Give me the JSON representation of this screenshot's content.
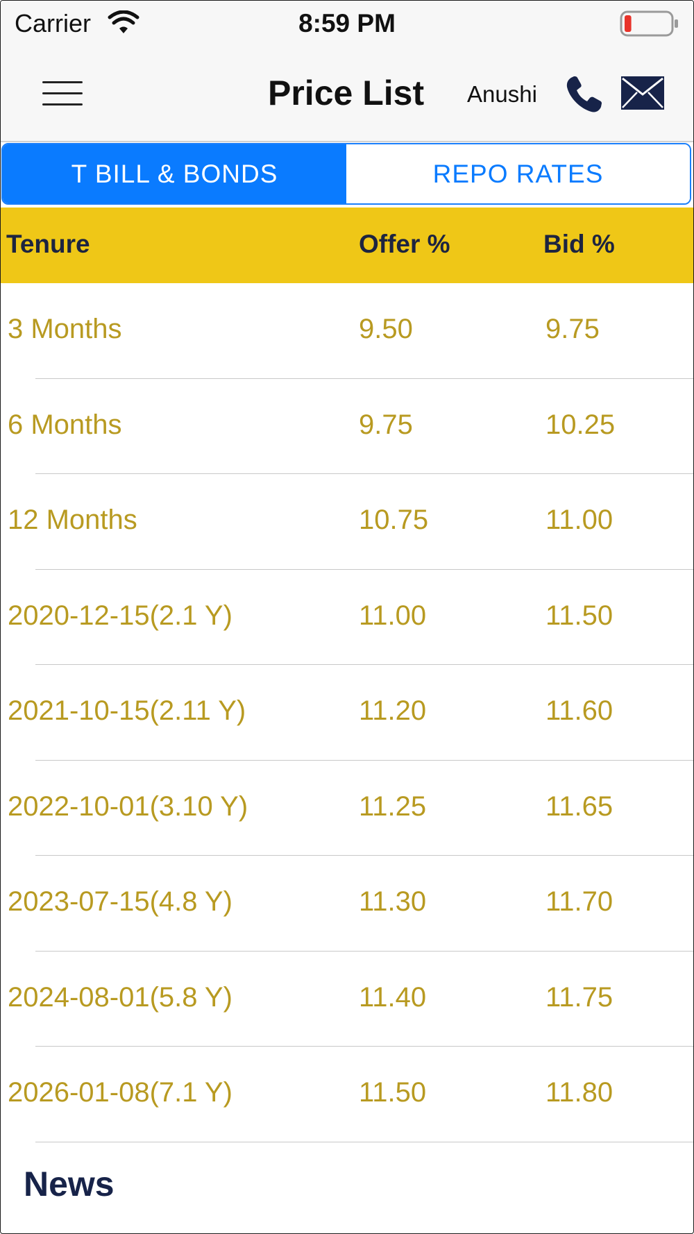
{
  "status_bar": {
    "carrier": "Carrier",
    "time": "8:59 PM",
    "battery_level": 0.1
  },
  "nav": {
    "title": "Price List",
    "user": "Anushi",
    "icons": [
      "menu-icon",
      "phone-icon",
      "mail-icon"
    ]
  },
  "tabs": [
    {
      "label": "T BILL & BONDS",
      "active": true
    },
    {
      "label": "REPO RATES",
      "active": false
    }
  ],
  "table": {
    "headers": {
      "tenure": "Tenure",
      "offer": "Offer %",
      "bid": "Bid %"
    },
    "rows": [
      {
        "tenure": "3 Months",
        "offer": "9.50",
        "bid": "9.75"
      },
      {
        "tenure": "6 Months",
        "offer": "9.75",
        "bid": "10.25"
      },
      {
        "tenure": "12 Months",
        "offer": "10.75",
        "bid": "11.00"
      },
      {
        "tenure": "2020-12-15(2.1 Y)",
        "offer": "11.00",
        "bid": "11.50"
      },
      {
        "tenure": "2021-10-15(2.11 Y)",
        "offer": "11.20",
        "bid": "11.60"
      },
      {
        "tenure": "2022-10-01(3.10 Y)",
        "offer": "11.25",
        "bid": "11.65"
      },
      {
        "tenure": "2023-07-15(4.8 Y)",
        "offer": "11.30",
        "bid": "11.70"
      },
      {
        "tenure": "2024-08-01(5.8 Y)",
        "offer": "11.40",
        "bid": "11.75"
      },
      {
        "tenure": "2026-01-08(7.1 Y)",
        "offer": "11.50",
        "bid": "11.80"
      }
    ]
  },
  "news": {
    "title": "News"
  },
  "colors": {
    "accent_blue": "#0a7bff",
    "header_yellow": "#efc717",
    "value_gold": "#b89a21",
    "dark_navy": "#172349",
    "battery_red": "#e8332a"
  }
}
